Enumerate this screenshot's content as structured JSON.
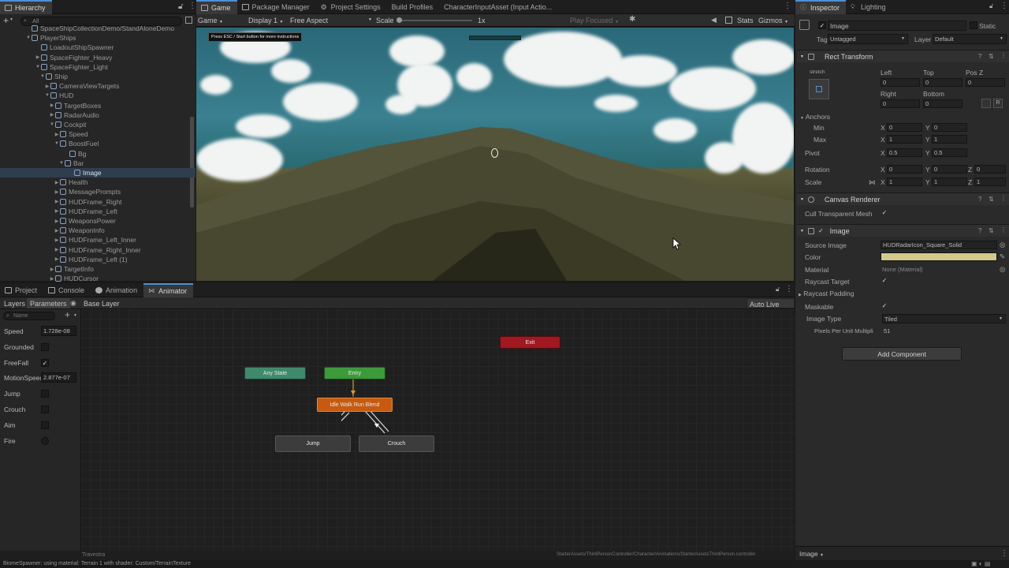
{
  "hierarchy": {
    "tab": "Hierarchy",
    "search": "All",
    "rows": [
      {
        "label": "SpaceShipCollectionDemo/StandAloneDemo"
      },
      {
        "label": "PlayerShips"
      },
      {
        "label": "LoadoutShipSpawner"
      },
      {
        "label": "SpaceFighter_Heavy"
      },
      {
        "label": "SpaceFighter_Light"
      },
      {
        "label": "Ship"
      },
      {
        "label": "CameraViewTargets"
      },
      {
        "label": "HUD"
      },
      {
        "label": "TargetBoxes"
      },
      {
        "label": "RadarAudio"
      },
      {
        "label": "Cockpit"
      },
      {
        "label": "Speed"
      },
      {
        "label": "BoostFuel"
      },
      {
        "label": "Bg"
      },
      {
        "label": "Bar"
      },
      {
        "label": "Image"
      },
      {
        "label": "Health"
      },
      {
        "label": "MessagePrompts"
      },
      {
        "label": "HUDFrame_Right"
      },
      {
        "label": "HUDFrame_Left"
      },
      {
        "label": "WeaponsPower"
      },
      {
        "label": "WeaponInfo"
      },
      {
        "label": "HUDFrame_Left_Inner"
      },
      {
        "label": "HUDFrame_Right_Inner"
      },
      {
        "label": "HUDFrame_Left (1)"
      },
      {
        "label": "TargetInfo"
      },
      {
        "label": "HUDCursor"
      }
    ]
  },
  "center_tabs": [
    {
      "label": "Game"
    },
    {
      "label": "Package Manager"
    },
    {
      "label": "Project Settings"
    },
    {
      "label": "Build Profiles"
    },
    {
      "label": "CharacterInputAsset (Input Actio..."
    }
  ],
  "game_toolbar": {
    "mode": "Game",
    "display": "Display 1",
    "aspect": "Free Aspect",
    "scale_label": "Scale",
    "scale_value": "1x",
    "play_focused": "Play Focused",
    "stats": "Stats",
    "gizmos": "Gizmos"
  },
  "game_overlay_text": "Press ESC / Start button for more instructions",
  "bottom_tabs": [
    {
      "label": "Project"
    },
    {
      "label": "Console"
    },
    {
      "label": "Animation"
    },
    {
      "label": "Animator"
    }
  ],
  "animator": {
    "layers_tab": "Layers",
    "parameters_tab": "Parameters",
    "base_layer": "Base Layer",
    "auto_live_link": "Auto Live Link",
    "search_placeholder": "Name",
    "footer_left": "Travestra",
    "footer_path": "StarterAssets/ThirdPersonController/Character/Animations/StarterAssetsThirdPerson.controller",
    "params": [
      {
        "name": "Speed",
        "type": "float",
        "value": "1.728e-08"
      },
      {
        "name": "Grounded",
        "type": "bool",
        "value": ""
      },
      {
        "name": "FreeFall",
        "type": "bool",
        "value": "✓"
      },
      {
        "name": "MotionSpeed",
        "type": "float",
        "value": "2.877e-07"
      },
      {
        "name": "Jump",
        "type": "bool",
        "value": ""
      },
      {
        "name": "Crouch",
        "type": "bool",
        "value": ""
      },
      {
        "name": "Aim",
        "type": "bool",
        "value": ""
      },
      {
        "name": "Fire",
        "type": "trigger",
        "value": ""
      }
    ],
    "states": {
      "exit": "Exit",
      "any_state": "Any State",
      "entry": "Entry",
      "blend": "Idle Walk Run Blend",
      "jump": "Jump",
      "crouch": "Crouch"
    }
  },
  "inspector": {
    "tab": "Inspector",
    "lighting_tab": "Lighting",
    "object_name": "Image",
    "static_label": "Static",
    "tag_label": "Tag",
    "tag_value": "Untagged",
    "layer_label": "Layer",
    "layer_value": "Default",
    "rect_transform": "Rect Transform",
    "stretch": "stretch",
    "left": "Left",
    "top": "Top",
    "posz": "Pos Z",
    "left_v": "0",
    "top_v": "0",
    "posz_v": "0",
    "right": "Right",
    "bottom": "Bottom",
    "right_v": "0",
    "bottom_v": "0",
    "anchors": "Anchors",
    "min": "Min",
    "max": "Max",
    "min_x": "0",
    "min_y": "0",
    "max_x": "1",
    "max_y": "1",
    "pivot": "Pivot",
    "pivot_x": "0.5",
    "pivot_y": "0.5",
    "rotation": "Rotation",
    "rot_x": "0",
    "rot_y": "0",
    "rot_z": "0",
    "scale": "Scale",
    "scale_x": "1",
    "scale_y": "1",
    "scale_z": "1",
    "canvas_renderer": "Canvas Renderer",
    "cull_mesh": "Cull Transparent Mesh",
    "image_comp": "Image",
    "source_image": "Source Image",
    "source_image_v": "HUDRadarIcon_Square_Solid",
    "color": "Color",
    "color_hex": "#d3c98a",
    "material": "Material",
    "material_v": "None (Material)",
    "raycast_target": "Raycast Target",
    "raycast_padding": "Raycast Padding",
    "maskable": "Maskable",
    "image_type": "Image Type",
    "image_type_v": "Tiled",
    "ppu": "Pixels Per Unit Multipli",
    "ppu_v": "51",
    "add_component": "Add Component",
    "footer": "Image"
  },
  "status_bar": "BiomeSpawner: using material: Terrain 1 with shader: Custom/TerrainTexture"
}
